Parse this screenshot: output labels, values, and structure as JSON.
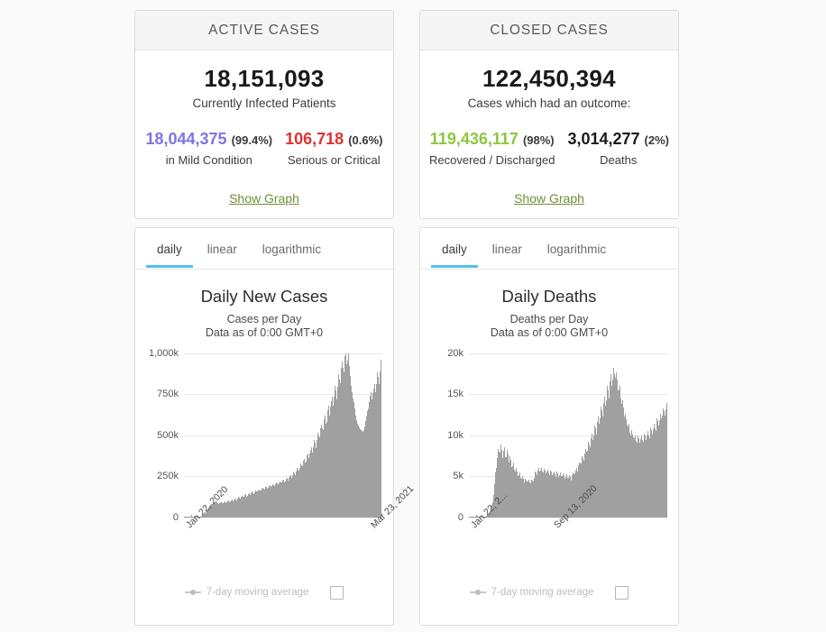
{
  "active_cases": {
    "header": "ACTIVE CASES",
    "total": "18,151,093",
    "total_caption": "Currently Infected Patients",
    "mild_value": "18,044,375",
    "mild_pct": "(99.4%)",
    "mild_caption": "in Mild Condition",
    "serious_value": "106,718",
    "serious_pct": "(0.6%)",
    "serious_caption": "Serious or Critical",
    "show_graph": "Show Graph",
    "colors": {
      "mild": "#7d74e8",
      "serious": "#e03131",
      "link": "#6f8f33"
    }
  },
  "closed_cases": {
    "header": "CLOSED CASES",
    "total": "122,450,394",
    "total_caption": "Cases which had an outcome:",
    "recovered_value": "119,436,117",
    "recovered_pct": "(98%)",
    "recovered_caption": "Recovered / Discharged",
    "deaths_value": "3,014,277",
    "deaths_pct": "(2%)",
    "deaths_caption": "Deaths",
    "show_graph": "Show Graph",
    "colors": {
      "recovered": "#8cc63f",
      "deaths": "#1a1a1a",
      "link": "#6f8f33"
    }
  },
  "cases_chart": {
    "tabs": [
      {
        "label": "daily",
        "active": true
      },
      {
        "label": "linear",
        "active": false
      },
      {
        "label": "logarithmic",
        "active": false
      }
    ],
    "legend_label": "7-day moving average",
    "legend_checked": false,
    "active_tab_color": "#4fc3e8"
  },
  "deaths_chart": {
    "tabs": [
      {
        "label": "daily",
        "active": true
      },
      {
        "label": "linear",
        "active": false
      },
      {
        "label": "logarithmic",
        "active": false
      }
    ],
    "legend_label": "7-day moving average",
    "legend_checked": false,
    "active_tab_color": "#4fc3e8"
  },
  "chart_data": [
    {
      "id": "cases",
      "type": "bar",
      "title": "Daily New Cases",
      "subtitle_line1": "Cases per Day",
      "subtitle_line2": "Data as of 0:00 GMT+0",
      "xlabel": "",
      "ylabel": "",
      "ylim": [
        0,
        1000000
      ],
      "yticks": [
        1000000,
        750000,
        500000,
        250000,
        0
      ],
      "ytick_labels": [
        "1,000k",
        "750k",
        "500k",
        "250k",
        "0"
      ],
      "xticks": [
        "Jan 22, 2020",
        "Mar 23, 2021"
      ],
      "xtick_positions": [
        0.0,
        0.93
      ],
      "grid": true,
      "bar_color": "#a0a0a0",
      "legend_position": "bottom",
      "values": [
        1500,
        2000,
        2600,
        3000,
        3500,
        3800,
        3200,
        3000,
        3400,
        4000,
        3600,
        3200,
        2800,
        2600,
        15000,
        5000,
        2600,
        2200,
        2000,
        1800,
        1700,
        1500,
        1400,
        1300,
        1200,
        1100,
        1000,
        1200,
        1500,
        1800,
        2200,
        2800,
        3500,
        4200,
        5000,
        6000,
        7000,
        8500,
        10000,
        12000,
        14000,
        16000,
        19000,
        22000,
        26000,
        30000,
        35000,
        40000,
        46000,
        52000,
        58000,
        63000,
        68000,
        72000,
        76000,
        78000,
        80000,
        82000,
        84000,
        86000,
        88000,
        84000,
        82000,
        80000,
        84000,
        88000,
        90000,
        86000,
        82000,
        80000,
        78000,
        80000,
        84000,
        88000,
        92000,
        88000,
        84000,
        82000,
        80000,
        84000,
        88000,
        92000,
        95000,
        90000,
        86000,
        84000,
        88000,
        92000,
        96000,
        100000,
        96000,
        92000,
        90000,
        94000,
        98000,
        102000,
        106000,
        100000,
        96000,
        94000,
        98000,
        104000,
        110000,
        114000,
        108000,
        102000,
        100000,
        106000,
        112000,
        118000,
        122000,
        116000,
        110000,
        108000,
        114000,
        120000,
        126000,
        130000,
        124000,
        118000,
        116000,
        122000,
        128000,
        134000,
        138000,
        132000,
        126000,
        124000,
        130000,
        136000,
        142000,
        146000,
        140000,
        134000,
        132000,
        138000,
        144000,
        150000,
        154000,
        148000,
        142000,
        140000,
        146000,
        152000,
        158000,
        162000,
        156000,
        150000,
        148000,
        154000,
        160000,
        166000,
        170000,
        164000,
        158000,
        156000,
        162000,
        168000,
        174000,
        178000,
        172000,
        166000,
        164000,
        170000,
        176000,
        182000,
        186000,
        180000,
        174000,
        172000,
        178000,
        184000,
        190000,
        194000,
        188000,
        182000,
        180000,
        186000,
        192000,
        198000,
        202000,
        196000,
        190000,
        188000,
        194000,
        200000,
        206000,
        210000,
        204000,
        198000,
        196000,
        202000,
        208000,
        214000,
        218000,
        212000,
        206000,
        204000,
        210000,
        216000,
        222000,
        226000,
        220000,
        214000,
        212000,
        218000,
        226000,
        234000,
        240000,
        232000,
        224000,
        220000,
        228000,
        238000,
        248000,
        256000,
        248000,
        240000,
        236000,
        246000,
        258000,
        268000,
        276000,
        268000,
        258000,
        254000,
        264000,
        278000,
        290000,
        300000,
        290000,
        278000,
        272000,
        284000,
        300000,
        316000,
        326000,
        316000,
        302000,
        296000,
        310000,
        328000,
        344000,
        356000,
        344000,
        330000,
        322000,
        338000,
        358000,
        376000,
        390000,
        376000,
        360000,
        352000,
        368000,
        390000,
        412000,
        428000,
        412000,
        394000,
        384000,
        404000,
        428000,
        452000,
        470000,
        452000,
        432000,
        422000,
        444000,
        470000,
        496000,
        516000,
        496000,
        474000,
        462000,
        486000,
        516000,
        544000,
        566000,
        544000,
        520000,
        506000,
        532000,
        564000,
        596000,
        620000,
        596000,
        568000,
        554000,
        582000,
        616000,
        650000,
        676000,
        650000,
        620000,
        604000,
        634000,
        672000,
        708000,
        736000,
        708000,
        676000,
        658000,
        692000,
        732000,
        772000,
        802000,
        772000,
        736000,
        716000,
        752000,
        796000,
        838000,
        872000,
        838000,
        800000,
        778000,
        818000,
        864000,
        910000,
        946000,
        908000,
        866000,
        842000,
        884000,
        934000,
        982000,
        1020000,
        980000,
        934000,
        908000,
        952000,
        1000000,
        960000,
        920000,
        890000,
        860000,
        830000,
        800000,
        780000,
        760000,
        740000,
        720000,
        700000,
        680000,
        660000,
        640000,
        620000,
        600000,
        590000,
        580000,
        570000,
        560000,
        550000,
        545000,
        540000,
        535000,
        530000,
        528000,
        526000,
        524000,
        522000,
        520000,
        525000,
        530000,
        540000,
        555000,
        570000,
        585000,
        600000,
        615000,
        630000,
        645000,
        660000,
        680000,
        700000,
        720000,
        740000,
        760000,
        740000,
        715000,
        700000,
        725000,
        755000,
        785000,
        810000,
        790000,
        760000,
        745000,
        775000,
        810000,
        845000,
        880000,
        855000,
        825000,
        810000,
        845000,
        885000,
        925000,
        960000
      ]
    },
    {
      "id": "deaths",
      "type": "bar",
      "title": "Daily Deaths",
      "subtitle_line1": "Deaths per Day",
      "subtitle_line2": "Data as of 0:00 GMT+0",
      "xlabel": "",
      "ylabel": "",
      "ylim": [
        0,
        20000
      ],
      "yticks": [
        20000,
        15000,
        10000,
        5000,
        0
      ],
      "ytick_labels": [
        "20k",
        "15k",
        "10k",
        "5k",
        "0"
      ],
      "xticks": [
        "Jan 22, 2...",
        "Sep 13, 2020"
      ],
      "xtick_positions": [
        0.0,
        0.42
      ],
      "grid": true,
      "bar_color": "#a0a0a0",
      "legend_position": "bottom",
      "values": [
        20,
        30,
        40,
        45,
        50,
        60,
        55,
        50,
        60,
        70,
        65,
        60,
        55,
        50,
        250,
        120,
        60,
        55,
        50,
        45,
        42,
        40,
        38,
        35,
        32,
        30,
        28,
        30,
        35,
        42,
        55,
        70,
        90,
        120,
        160,
        210,
        280,
        360,
        460,
        580,
        720,
        880,
        1060,
        1260,
        1500,
        1800,
        2200,
        2700,
        3300,
        4000,
        4700,
        5400,
        6000,
        6600,
        7200,
        7800,
        8300,
        8000,
        7600,
        7900,
        8400,
        8800,
        8200,
        7600,
        7200,
        7600,
        8100,
        8500,
        7900,
        7300,
        6900,
        7300,
        7800,
        8200,
        7600,
        7000,
        6600,
        7000,
        7400,
        7000,
        6500,
        6100,
        5800,
        6200,
        6600,
        6200,
        5800,
        5500,
        5200,
        5600,
        6000,
        5600,
        5200,
        5000,
        4800,
        5100,
        5400,
        5100,
        4800,
        4600,
        4400,
        4700,
        5000,
        4700,
        4400,
        4200,
        4100,
        4400,
        4700,
        4500,
        4300,
        4100,
        4000,
        4300,
        4600,
        4400,
        4200,
        4100,
        4000,
        4300,
        4600,
        4500,
        4300,
        4200,
        4400,
        4800,
        5200,
        5600,
        5400,
        5100,
        5000,
        5300,
        5700,
        6000,
        5800,
        5500,
        5400,
        5700,
        6000,
        5800,
        5600,
        5400,
        5300,
        5600,
        5900,
        5700,
        5500,
        5300,
        5200,
        5500,
        5800,
        5600,
        5400,
        5200,
        5100,
        5400,
        5700,
        5500,
        5300,
        5100,
        5000,
        5300,
        5600,
        5400,
        5200,
        5000,
        4900,
        5200,
        5500,
        5300,
        5100,
        4900,
        4800,
        5100,
        5400,
        5200,
        5000,
        4800,
        4700,
        5000,
        5300,
        5100,
        4900,
        4700,
        4600,
        4900,
        5200,
        5000,
        4800,
        4600,
        4500,
        4800,
        5100,
        4900,
        4700,
        4500,
        4400,
        4700,
        5100,
        5400,
        5200,
        5000,
        4900,
        5300,
        5700,
        6000,
        5800,
        5500,
        5400,
        5800,
        6300,
        6700,
        6500,
        6200,
        6100,
        6500,
        7000,
        7400,
        7200,
        6900,
        6800,
        7300,
        7800,
        8300,
        8000,
        7700,
        7600,
        8100,
        8700,
        9200,
        8900,
        8500,
        8400,
        9000,
        9600,
        10200,
        9800,
        9400,
        9200,
        9900,
        10600,
        11200,
        10800,
        10300,
        10100,
        10800,
        11600,
        12300,
        11900,
        11400,
        11200,
        12000,
        12800,
        13500,
        13000,
        12400,
        12200,
        13000,
        13900,
        14700,
        14200,
        13600,
        13300,
        14200,
        15200,
        16000,
        15400,
        14700,
        14400,
        15400,
        16500,
        17400,
        16800,
        16000,
        15700,
        16800,
        17900,
        18200,
        17400,
        16500,
        16200,
        17000,
        17600,
        16800,
        15900,
        15400,
        15000,
        15600,
        16000,
        15200,
        14400,
        13800,
        13400,
        13800,
        14200,
        13400,
        12700,
        12200,
        11800,
        12200,
        12600,
        11900,
        11300,
        10900,
        10600,
        11000,
        11400,
        10800,
        10300,
        10000,
        9800,
        10200,
        10600,
        10100,
        9700,
        9400,
        9200,
        9600,
        10000,
        9600,
        9300,
        9100,
        9000,
        9400,
        9900,
        9600,
        9300,
        9100,
        9000,
        9500,
        10000,
        9700,
        9400,
        9200,
        9100,
        9600,
        10200,
        9900,
        9600,
        9400,
        9300,
        9900,
        10500,
        10200,
        9900,
        9700,
        9600,
        10200,
        10900,
        10600,
        10300,
        10100,
        10000,
        10700,
        11400,
        11100,
        10800,
        10600,
        10500,
        11200,
        12000,
        11700,
        11400,
        11200,
        11100,
        11800,
        12600,
        12300,
        12000,
        11800,
        11700,
        12400,
        13200,
        12900,
        12600,
        12400,
        12300,
        13100,
        13900,
        13600
      ]
    }
  ]
}
